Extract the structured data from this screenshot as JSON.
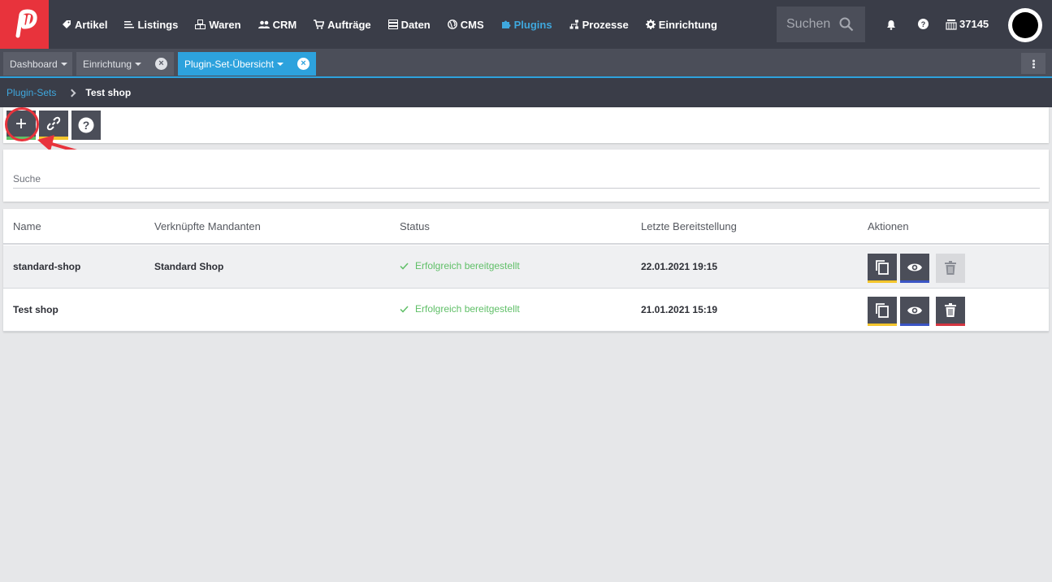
{
  "nav": {
    "items": [
      {
        "label": "Artikel",
        "icon": "tag-icon",
        "active": false
      },
      {
        "label": "Listings",
        "icon": "listings-icon",
        "active": false
      },
      {
        "label": "Waren",
        "icon": "boxes-icon",
        "active": false
      },
      {
        "label": "CRM",
        "icon": "people-icon",
        "active": false
      },
      {
        "label": "Aufträge",
        "icon": "cart-icon",
        "active": false
      },
      {
        "label": "Daten",
        "icon": "database-icon",
        "active": false
      },
      {
        "label": "CMS",
        "icon": "globe-icon",
        "active": false
      },
      {
        "label": "Plugins",
        "icon": "puzzle-icon",
        "active": true
      },
      {
        "label": "Prozesse",
        "icon": "process-icon",
        "active": false
      },
      {
        "label": "Einrichtung",
        "icon": "gear-icon",
        "active": false
      }
    ],
    "search_placeholder": "Suchen",
    "plenty_id": "37145",
    "accent": "#3fa8de",
    "logo_color": "#e8333c"
  },
  "tabs": [
    {
      "label": "Dashboard",
      "closable": false,
      "active": false
    },
    {
      "label": "Einrichtung",
      "closable": true,
      "active": false
    },
    {
      "label": "Plugin-Set-Übersicht",
      "closable": true,
      "active": true
    }
  ],
  "breadcrumb": {
    "parent": "Plugin-Sets",
    "current": "Test shop"
  },
  "search": {
    "placeholder": "Suche"
  },
  "table": {
    "headers": [
      "Name",
      "Verknüpfte Mandanten",
      "Status",
      "Letzte Bereitstellung",
      "Aktionen"
    ],
    "rows": [
      {
        "name": "standard-shop",
        "clients": "Standard Shop",
        "status": "Erfolgreich bereitgestellt",
        "last_deploy": "22.01.2021 19:15",
        "delete_enabled": false
      },
      {
        "name": "Test shop",
        "clients": "",
        "status": "Erfolgreich bereitgestellt",
        "last_deploy": "21.01.2021 15:19",
        "delete_enabled": true
      }
    ]
  },
  "colors": {
    "success": "#5fbf67",
    "warning": "#f3c52c",
    "info": "#3b55c4",
    "danger": "#d43641",
    "annotation": "#e8333c"
  }
}
